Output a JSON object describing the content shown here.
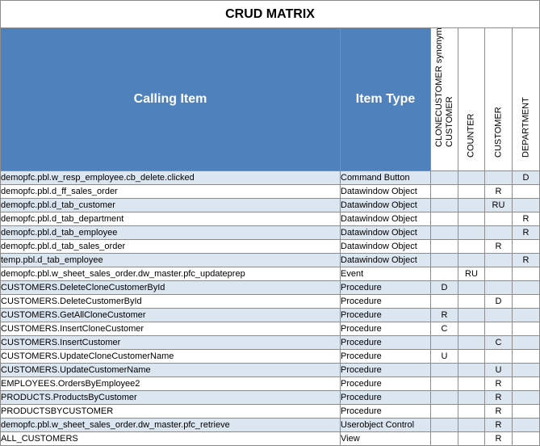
{
  "title": "CRUD MATRIX",
  "headers": {
    "calling_item": "Calling Item",
    "item_type": "Item Type",
    "columns": [
      {
        "label": "CLONECUSTOMER synonym of CUSTOMER"
      },
      {
        "label": "COUNTER"
      },
      {
        "label": "CUSTOMER"
      },
      {
        "label": "DEPARTMENT"
      }
    ]
  },
  "rows": [
    {
      "name": "demopfc.pbl.w_resp_employee.cb_delete.clicked",
      "type": "Command Button",
      "ops": [
        "",
        "",
        "",
        "D"
      ]
    },
    {
      "name": "demopfc.pbl.d_ff_sales_order",
      "type": "Datawindow Object",
      "ops": [
        "",
        "",
        "R",
        ""
      ]
    },
    {
      "name": "demopfc.pbl.d_tab_customer",
      "type": "Datawindow Object",
      "ops": [
        "",
        "",
        "RU",
        ""
      ]
    },
    {
      "name": "demopfc.pbl.d_tab_department",
      "type": "Datawindow Object",
      "ops": [
        "",
        "",
        "",
        "R"
      ]
    },
    {
      "name": "demopfc.pbl.d_tab_employee",
      "type": "Datawindow Object",
      "ops": [
        "",
        "",
        "",
        "R"
      ]
    },
    {
      "name": "demopfc.pbl.d_tab_sales_order",
      "type": "Datawindow Object",
      "ops": [
        "",
        "",
        "R",
        ""
      ]
    },
    {
      "name": "temp.pbl.d_tab_employee",
      "type": "Datawindow Object",
      "ops": [
        "",
        "",
        "",
        "R"
      ]
    },
    {
      "name": "demopfc.pbl.w_sheet_sales_order.dw_master.pfc_updateprep",
      "type": "Event",
      "ops": [
        "",
        "RU",
        "",
        ""
      ]
    },
    {
      "name": "CUSTOMERS.DeleteCloneCustomerById",
      "type": "Procedure",
      "ops": [
        "D",
        "",
        "",
        ""
      ]
    },
    {
      "name": "CUSTOMERS.DeleteCustomerById",
      "type": "Procedure",
      "ops": [
        "",
        "",
        "D",
        ""
      ]
    },
    {
      "name": "CUSTOMERS.GetAllCloneCustomer",
      "type": "Procedure",
      "ops": [
        "R",
        "",
        "",
        ""
      ]
    },
    {
      "name": "CUSTOMERS.InsertCloneCustomer",
      "type": "Procedure",
      "ops": [
        "C",
        "",
        "",
        ""
      ]
    },
    {
      "name": "CUSTOMERS.InsertCustomer",
      "type": "Procedure",
      "ops": [
        "",
        "",
        "C",
        ""
      ]
    },
    {
      "name": "CUSTOMERS.UpdateCloneCustomerName",
      "type": "Procedure",
      "ops": [
        "U",
        "",
        "",
        ""
      ]
    },
    {
      "name": "CUSTOMERS.UpdateCustomerName",
      "type": "Procedure",
      "ops": [
        "",
        "",
        "U",
        ""
      ]
    },
    {
      "name": "EMPLOYEES.OrdersByEmployee2",
      "type": "Procedure",
      "ops": [
        "",
        "",
        "R",
        ""
      ]
    },
    {
      "name": "PRODUCTS.ProductsByCustomer",
      "type": "Procedure",
      "ops": [
        "",
        "",
        "R",
        ""
      ]
    },
    {
      "name": "PRODUCTSBYCUSTOMER",
      "type": "Procedure",
      "ops": [
        "",
        "",
        "R",
        ""
      ]
    },
    {
      "name": "demopfc.pbl.w_sheet_sales_order.dw_master.pfc_retrieve",
      "type": "Userobject Control",
      "ops": [
        "",
        "",
        "R",
        ""
      ]
    },
    {
      "name": "ALL_CUSTOMERS",
      "type": "View",
      "ops": [
        "",
        "",
        "R",
        ""
      ]
    }
  ],
  "colors": {
    "header_blue": "#4f81bd",
    "row_shade": "#dce6f1",
    "row_plain": "#ffffff"
  }
}
